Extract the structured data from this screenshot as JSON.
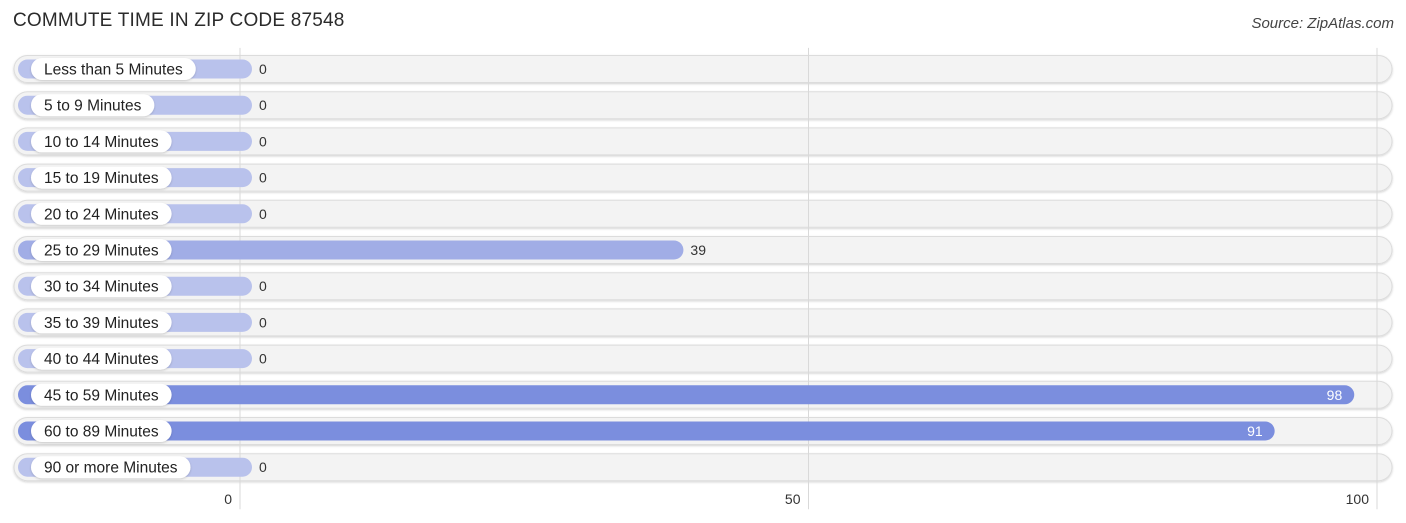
{
  "chart_data": {
    "type": "bar",
    "orientation": "horizontal",
    "title": "COMMUTE TIME IN ZIP CODE 87548",
    "source": "Source: ZipAtlas.com",
    "categories": [
      "Less than 5 Minutes",
      "5 to 9 Minutes",
      "10 to 14 Minutes",
      "15 to 19 Minutes",
      "20 to 24 Minutes",
      "25 to 29 Minutes",
      "30 to 34 Minutes",
      "35 to 39 Minutes",
      "40 to 44 Minutes",
      "45 to 59 Minutes",
      "60 to 89 Minutes",
      "90 or more Minutes"
    ],
    "values": [
      0,
      0,
      0,
      0,
      0,
      39,
      0,
      0,
      0,
      98,
      91,
      0
    ],
    "xlabel": "",
    "ylabel": "",
    "xlim": [
      0,
      100
    ],
    "xticks": [
      0,
      50,
      100
    ],
    "grid": true,
    "legend": "none",
    "colors": {
      "bar_low": "#b9c2ec",
      "bar_mid": "#a1ade6",
      "bar_high": "#7b8ede",
      "track": "#f3f3f3",
      "track_border": "#dcdcdc",
      "grid": "#d9d9d9"
    }
  }
}
